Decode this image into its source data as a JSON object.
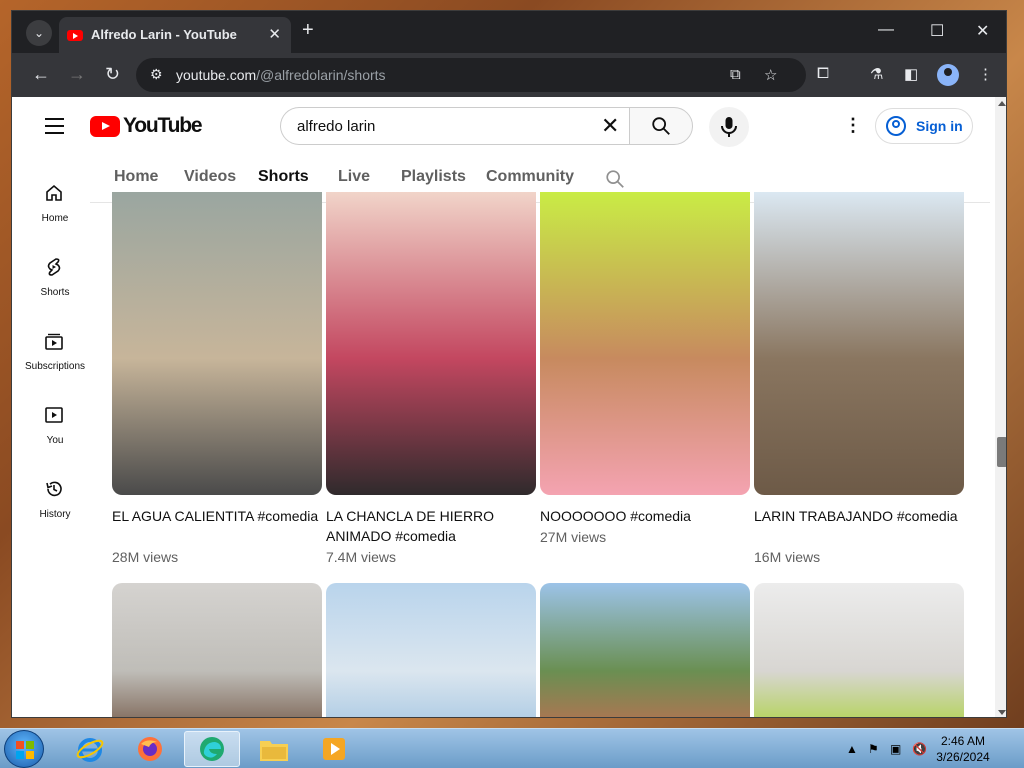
{
  "browser": {
    "tab_title": "Alfredo Larin - YouTube",
    "tab_close": "✕",
    "new_tab": "+",
    "url_host": "youtube.com",
    "url_path": "/@alfredolarin/shorts",
    "min": "—",
    "max": "☐",
    "close": "✕"
  },
  "youtube": {
    "logo_text": "YouTube",
    "search_value": "alfredo larin",
    "sign_in": "Sign in",
    "sidebar": [
      {
        "label": "Home",
        "icon": "home-icon"
      },
      {
        "label": "Shorts",
        "icon": "shorts-icon"
      },
      {
        "label": "Subscriptions",
        "icon": "subscriptions-icon"
      },
      {
        "label": "You",
        "icon": "you-icon"
      },
      {
        "label": "History",
        "icon": "history-icon"
      }
    ],
    "channel_tabs": [
      "Home",
      "Videos",
      "Shorts",
      "Live",
      "Playlists",
      "Community"
    ],
    "active_tab": "Shorts",
    "shorts": [
      {
        "title": "EL AGUA CALIENTITA #comedia",
        "views": "28M views",
        "colors": [
          "#9aa6a0",
          "#c7b59a",
          "#4a4a4a"
        ]
      },
      {
        "title": "LA CHANCLA DE HIERRO ANIMADO #comedia",
        "views": "7.4M views",
        "colors": [
          "#f1d4c9",
          "#c34760",
          "#2f2a2c"
        ]
      },
      {
        "title": "NOOOOOOO #comedia",
        "views": "27M views",
        "colors": [
          "#c9ec45",
          "#c78a5f",
          "#f4a3b1"
        ]
      },
      {
        "title": "LARIN TRABAJANDO #comedia",
        "views": "16M views",
        "colors": [
          "#dbe8f2",
          "#8a7660",
          "#6d5a47"
        ]
      },
      {
        "title": "",
        "views": "",
        "colors": [
          "#d5d3d0",
          "#bfbdb8",
          "#6a4d3a"
        ]
      },
      {
        "title": "",
        "views": "",
        "colors": [
          "#b9d4ec",
          "#dbe6ef",
          "#9ec2e0"
        ]
      },
      {
        "title": "",
        "views": "",
        "colors": [
          "#9cc3e8",
          "#6a8f52",
          "#c86b52"
        ]
      },
      {
        "title": "",
        "views": "",
        "colors": [
          "#ececec",
          "#d8d6d2",
          "#a7d22e"
        ]
      }
    ]
  },
  "taskbar": {
    "time": "2:46 AM",
    "date": "3/26/2024"
  }
}
